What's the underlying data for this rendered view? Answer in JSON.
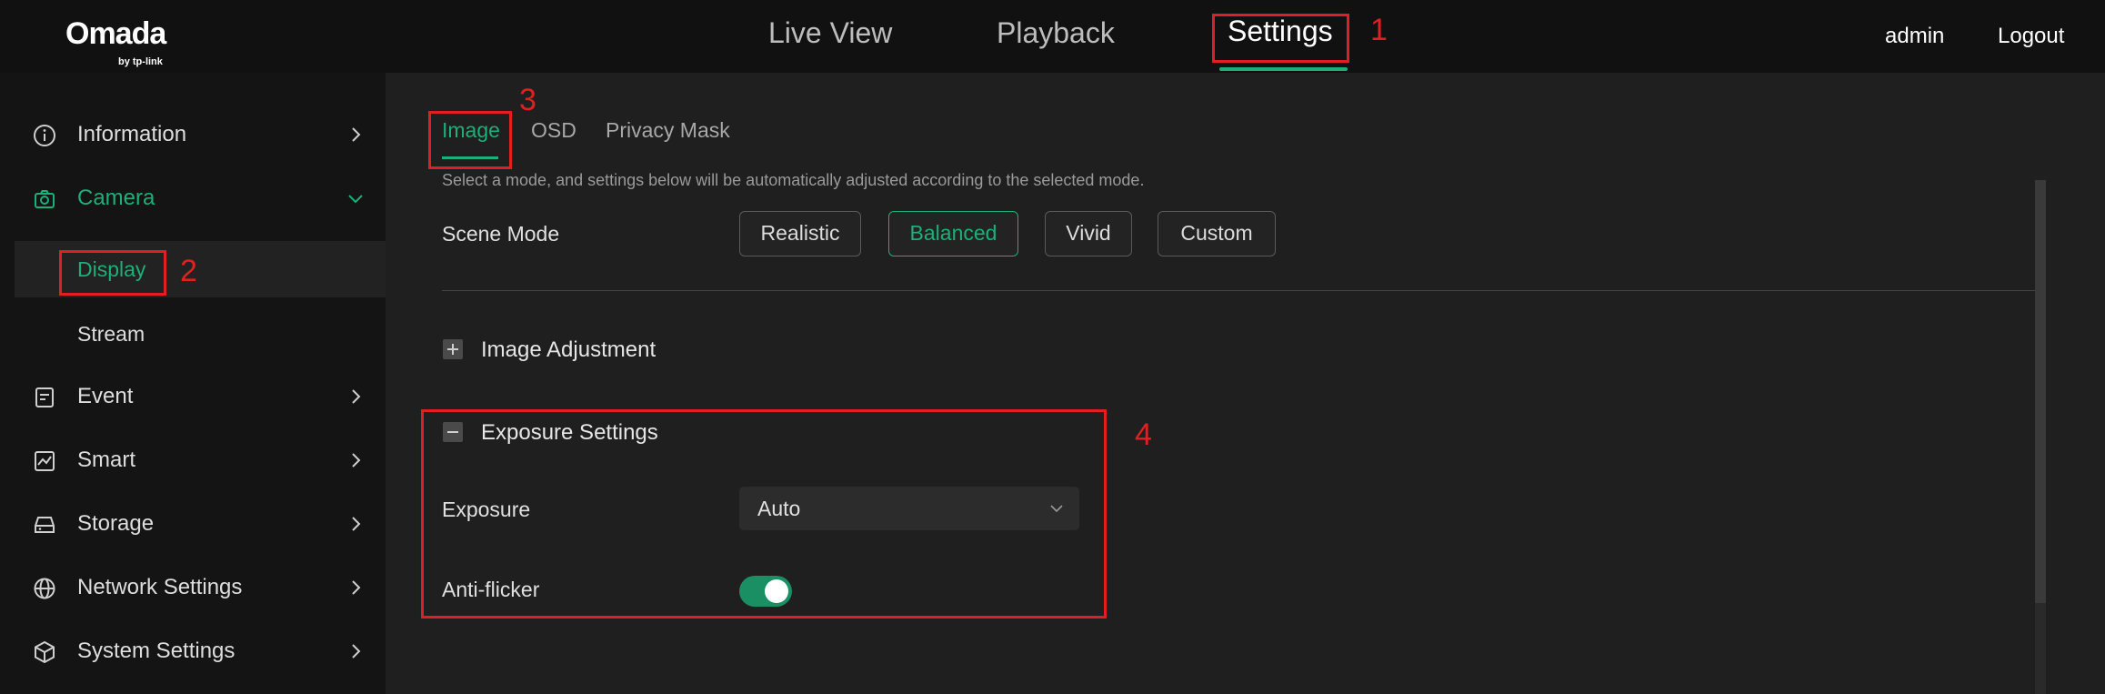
{
  "app": {
    "logo_main": "Omada",
    "logo_sub": "by tp-link",
    "accent_color": "#1bb07a",
    "annotation_color": "#e02020"
  },
  "topnav": {
    "tabs": [
      {
        "label": "Live View"
      },
      {
        "label": "Playback"
      },
      {
        "label": "Settings",
        "active": true
      }
    ],
    "user": "admin",
    "logout": "Logout"
  },
  "sidebar": {
    "items": [
      {
        "label": "Information",
        "icon": "info-icon"
      },
      {
        "label": "Camera",
        "icon": "camera-icon",
        "expanded": true
      },
      {
        "label": "Display",
        "sub": true,
        "selected": true
      },
      {
        "label": "Stream",
        "sub": true
      },
      {
        "label": "Event",
        "icon": "event-icon"
      },
      {
        "label": "Smart",
        "icon": "smart-icon"
      },
      {
        "label": "Storage",
        "icon": "storage-icon"
      },
      {
        "label": "Network Settings",
        "icon": "globe-icon"
      },
      {
        "label": "System Settings",
        "icon": "system-icon"
      }
    ]
  },
  "main": {
    "tabs": [
      {
        "label": "Image",
        "active": true
      },
      {
        "label": "OSD"
      },
      {
        "label": "Privacy Mask"
      }
    ],
    "description": "Select a mode, and settings below will be automatically adjusted according to the selected mode.",
    "scene_mode": {
      "label": "Scene Mode",
      "options": [
        "Realistic",
        "Balanced",
        "Vivid",
        "Custom"
      ],
      "selected": "Balanced"
    },
    "image_adjustment": {
      "title": "Image Adjustment",
      "expanded": false
    },
    "exposure_settings": {
      "title": "Exposure Settings",
      "expanded": true,
      "exposure_label": "Exposure",
      "exposure_value": "Auto",
      "antiflicker_label": "Anti-flicker",
      "antiflicker_on": true
    }
  },
  "annotations": [
    "1",
    "2",
    "3",
    "4"
  ]
}
